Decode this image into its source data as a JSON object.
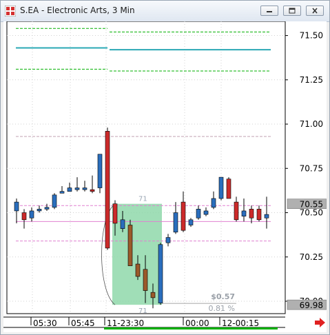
{
  "window": {
    "title": "S.EA - Electronic Arts, 3 Min",
    "icons": [
      "app-grid-icon",
      "minimize-icon",
      "restore-icon",
      "close-icon"
    ]
  },
  "chart_data": {
    "type": "candlestick",
    "ylim": [
      69.93,
      71.58
    ],
    "y_ticks": [
      71.5,
      71.25,
      71.0,
      70.75,
      70.5,
      70.25,
      70.0
    ],
    "y_tick_labels": [
      "71.50",
      "71.25",
      "71.00",
      "70.75",
      "70.50",
      "70.25",
      "70.00"
    ],
    "x_tick_labels": [
      "05:30",
      "05:45",
      "11-23:30",
      "00:00",
      "12-00:15"
    ],
    "price_labels": {
      "last": "70.55",
      "low": "69.98"
    },
    "colors": {
      "up": "#2a6ebd",
      "down": "#cc2a2a",
      "sell_bar": "#9b5a2a",
      "grid": "#d0d0d0",
      "band_green": "#00b000",
      "band_teal": "#2aa8b4",
      "level_magenta": "#e080d0",
      "level_gray": "#c0a0b0",
      "measure_fill": "#8fd8aa",
      "axis_label_bg": "#b0b0b0",
      "scroll_arrow": "#e02020"
    },
    "candles": [
      {
        "o": 70.51,
        "h": 70.58,
        "l": 70.44,
        "c": 70.56
      },
      {
        "o": 70.5,
        "h": 70.52,
        "l": 70.41,
        "c": 70.46
      },
      {
        "o": 70.47,
        "h": 70.53,
        "l": 70.45,
        "c": 70.51
      },
      {
        "o": 70.51,
        "h": 70.54,
        "l": 70.5,
        "c": 70.52
      },
      {
        "o": 70.52,
        "h": 70.55,
        "l": 70.51,
        "c": 70.53
      },
      {
        "o": 70.53,
        "h": 70.61,
        "l": 70.52,
        "c": 70.6
      },
      {
        "o": 70.61,
        "h": 70.65,
        "l": 70.61,
        "c": 70.62
      },
      {
        "o": 70.62,
        "h": 70.67,
        "l": 70.62,
        "c": 70.64
      },
      {
        "o": 70.63,
        "h": 70.7,
        "l": 70.62,
        "c": 70.64
      },
      {
        "o": 70.63,
        "h": 70.68,
        "l": 70.62,
        "c": 70.64
      },
      {
        "o": 70.63,
        "h": 70.71,
        "l": 70.61,
        "c": 70.62
      },
      {
        "o": 70.64,
        "h": 70.83,
        "l": 70.61,
        "c": 70.83
      },
      {
        "o": 70.96,
        "h": 70.98,
        "l": 70.29,
        "c": 70.3
      },
      {
        "o": 70.55,
        "h": 70.57,
        "l": 70.37,
        "c": 70.44
      },
      {
        "o": 70.41,
        "h": 70.51,
        "l": 70.39,
        "c": 70.46
      },
      {
        "o": 70.43,
        "h": 70.46,
        "l": 70.2,
        "c": 70.2
      },
      {
        "o": 70.21,
        "h": 70.26,
        "l": 70.12,
        "c": 70.14
      },
      {
        "o": 70.18,
        "h": 70.26,
        "l": 69.99,
        "c": 70.06
      },
      {
        "o": 70.05,
        "h": 70.1,
        "l": 69.96,
        "c": 70.02
      },
      {
        "o": 69.99,
        "h": 70.33,
        "l": 69.98,
        "c": 70.32
      },
      {
        "o": 70.33,
        "h": 70.38,
        "l": 70.31,
        "c": 70.36
      },
      {
        "o": 70.39,
        "h": 70.56,
        "l": 70.38,
        "c": 70.5
      },
      {
        "o": 70.56,
        "h": 70.62,
        "l": 70.39,
        "c": 70.4
      },
      {
        "o": 70.43,
        "h": 70.47,
        "l": 70.42,
        "c": 70.46
      },
      {
        "o": 70.47,
        "h": 70.54,
        "l": 70.46,
        "c": 70.52
      },
      {
        "o": 70.49,
        "h": 70.53,
        "l": 70.48,
        "c": 70.51
      },
      {
        "o": 70.53,
        "h": 70.62,
        "l": 70.52,
        "c": 70.58
      },
      {
        "o": 70.58,
        "h": 70.7,
        "l": 70.57,
        "c": 70.7
      },
      {
        "o": 70.69,
        "h": 70.7,
        "l": 70.58,
        "c": 70.58
      },
      {
        "o": 70.56,
        "h": 70.59,
        "l": 70.45,
        "c": 70.46
      },
      {
        "o": 70.48,
        "h": 70.58,
        "l": 70.45,
        "c": 70.51
      },
      {
        "o": 70.52,
        "h": 70.54,
        "l": 70.44,
        "c": 70.47
      },
      {
        "o": 70.52,
        "h": 70.54,
        "l": 70.45,
        "c": 70.46
      },
      {
        "o": 70.47,
        "h": 70.59,
        "l": 70.41,
        "c": 70.49
      }
    ],
    "lines": [
      {
        "name": "",
        "style": "dashed",
        "color": "#00b000",
        "segments": [
          [
            0,
            12,
            71.54
          ],
          [
            12,
            33,
            71.52
          ]
        ]
      },
      {
        "name": "",
        "style": "solid",
        "color": "#2aa8b4",
        "segments": [
          [
            0,
            12,
            71.43
          ],
          [
            12,
            33,
            71.42
          ]
        ]
      },
      {
        "name": "",
        "style": "dashed",
        "color": "#00b000",
        "segments": [
          [
            0,
            12,
            71.31
          ],
          [
            12,
            33,
            71.3
          ]
        ]
      },
      {
        "name": "",
        "style": "dashed",
        "color": "#c0a0b0",
        "segments": [
          [
            0,
            33,
            70.93
          ]
        ]
      },
      {
        "name": "",
        "style": "dashed",
        "color": "#e080d0",
        "segments": [
          [
            0,
            33,
            70.54
          ]
        ]
      },
      {
        "name": "",
        "style": "solid",
        "color": "#e080d0",
        "segments": [
          [
            0,
            33,
            70.45
          ]
        ]
      },
      {
        "name": "",
        "style": "dashed",
        "color": "#e080d0",
        "segments": [
          [
            0,
            33,
            70.34
          ]
        ]
      }
    ],
    "measure_box": {
      "start_index": 13,
      "end_index": 19,
      "from_price": 70.55,
      "to_price": 69.98,
      "top_label": "71",
      "bottom_label": "71",
      "delta_text": "$0.57",
      "pct_text": "0.81 %"
    }
  }
}
